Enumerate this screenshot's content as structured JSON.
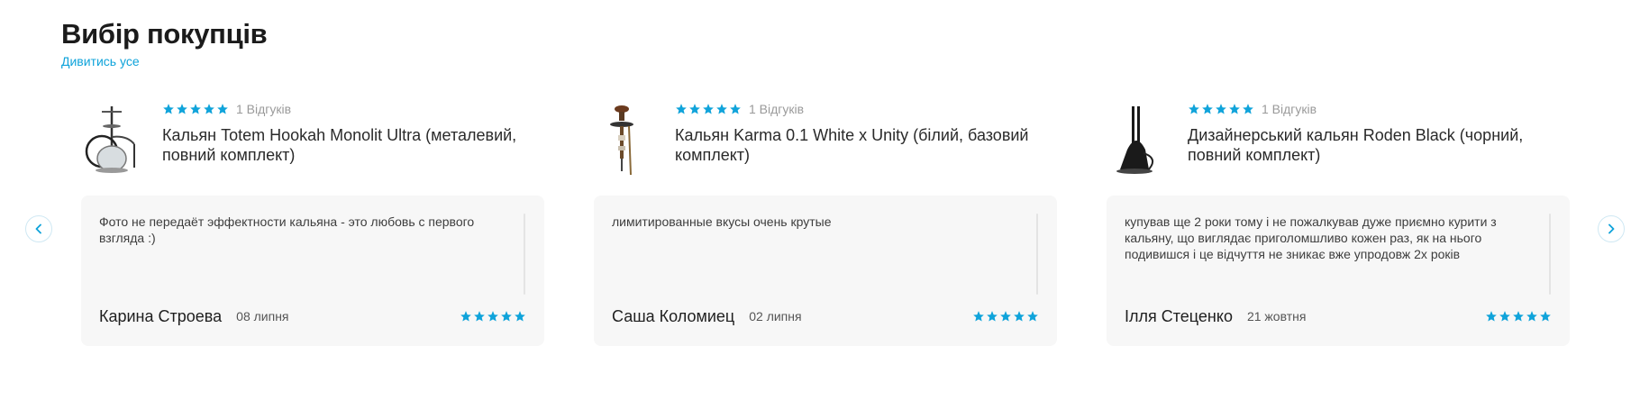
{
  "section": {
    "title": "Вибір покупців",
    "view_all": "Дивитись усе"
  },
  "accent_color": "#0fa3da",
  "navigation": {
    "prev_icon": "chevron-left-icon",
    "next_icon": "chevron-right-icon"
  },
  "cards": [
    {
      "product_name": "Кальян Totem Hookah Monolit Ultra (металевий, повний комплект)",
      "rating": 5,
      "reviews_count": "1 Відгуків",
      "review_text": "Фото не передаёт эффектности кальяна - это любовь с первого взгляда :)",
      "reviewer": "Карина Строева",
      "date": "08 липня",
      "review_rating": 5
    },
    {
      "product_name": "Кальян Karma 0.1 White x Unity (білий, базовий комплект)",
      "rating": 5,
      "reviews_count": "1 Відгуків",
      "review_text": "лимитированные вкусы очень крутые",
      "reviewer": "Саша Коломиец",
      "date": "02 липня",
      "review_rating": 5
    },
    {
      "product_name": "Дизайнерський кальян Roden Black (чорний, повний комплект)",
      "rating": 5,
      "reviews_count": "1 Відгуків",
      "review_text": "купував ще 2 роки тому і не пожалкував дуже приємно курити з кальяну, що виглядає приголомшливо кожен раз, як на нього подивишся і це відчуття не зникає вже упродовж 2х років",
      "reviewer": "Ілля Стеценко",
      "date": "21 жовтня",
      "review_rating": 5
    }
  ]
}
